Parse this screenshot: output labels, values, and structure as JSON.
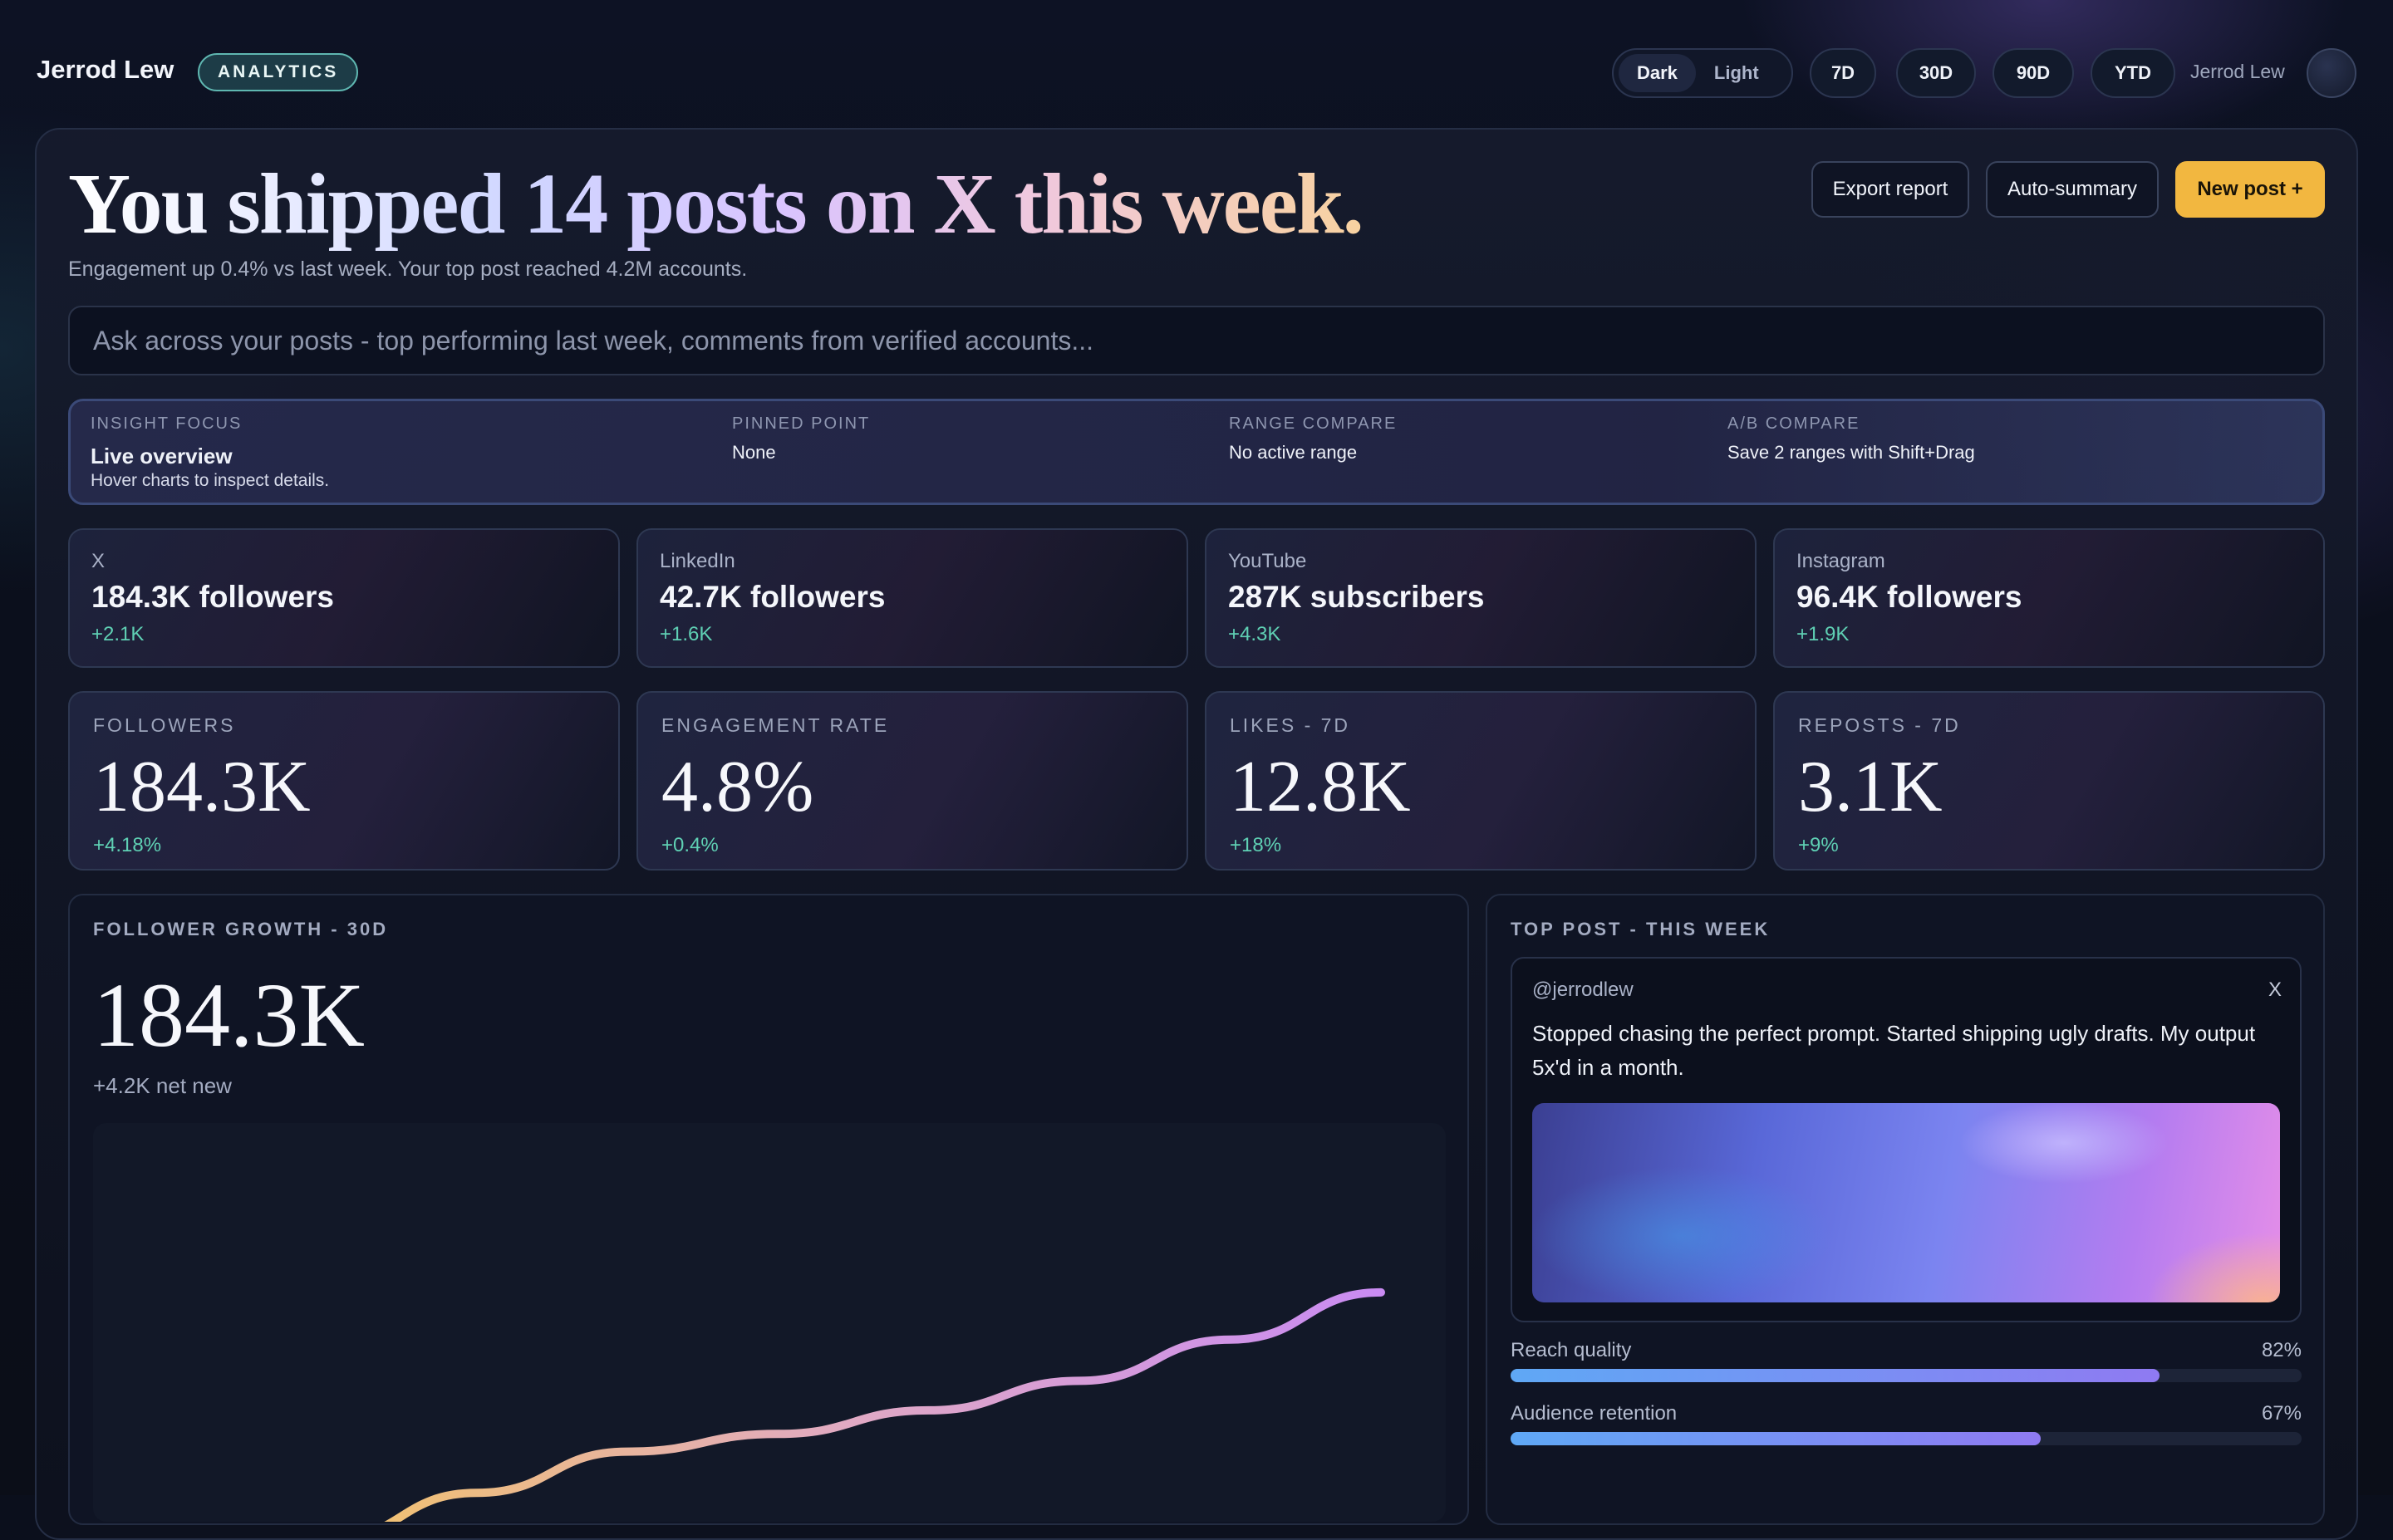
{
  "header": {
    "brand": "Jerrod Lew",
    "tag": "ANALYTICS",
    "theme_options": [
      "Dark",
      "Light"
    ],
    "theme_active": "Dark",
    "ranges": [
      "7D",
      "30D",
      "90D",
      "YTD"
    ],
    "user_name": "Jerrod Lew"
  },
  "hero": {
    "title": "You shipped 14 posts on X this week.",
    "subtitle": "Engagement up 0.4% vs last week. Your top post reached 4.2M accounts."
  },
  "actions": {
    "export": "Export report",
    "summary": "Auto-summary",
    "new_post": "New post +"
  },
  "search": {
    "placeholder": "Ask across your posts - top performing last week, comments from verified accounts..."
  },
  "insight": {
    "focus_label": "INSIGHT FOCUS",
    "focus_value": "Live overview",
    "focus_hint": "Hover charts to inspect details.",
    "pinned_label": "PINNED POINT",
    "pinned_value": "None",
    "range_label": "RANGE COMPARE",
    "range_value": "No active range",
    "ab_label": "A/B COMPARE",
    "ab_value": "Save 2 ranges with Shift+Drag"
  },
  "networks": [
    {
      "name": "X",
      "count": "184.3K followers",
      "delta": "+2.1K"
    },
    {
      "name": "LinkedIn",
      "count": "42.7K followers",
      "delta": "+1.6K"
    },
    {
      "name": "YouTube",
      "count": "287K subscribers",
      "delta": "+4.3K"
    },
    {
      "name": "Instagram",
      "count": "96.4K followers",
      "delta": "+1.9K"
    }
  ],
  "kpis": [
    {
      "label": "FOLLOWERS",
      "value": "184.3K",
      "delta": "+4.18%"
    },
    {
      "label": "ENGAGEMENT RATE",
      "value": "4.8%",
      "delta": "+0.4%"
    },
    {
      "label": "LIKES - 7D",
      "value": "12.8K",
      "delta": "+18%"
    },
    {
      "label": "REPOSTS - 7D",
      "value": "3.1K",
      "delta": "+9%"
    }
  ],
  "growth": {
    "label": "FOLLOWER GROWTH - 30D",
    "value": "184.3K",
    "net": "+4.2K net new"
  },
  "chart_data": {
    "type": "line",
    "title": "",
    "series": [
      {
        "values": [
          180.1,
          180.9,
          181.6,
          181.9,
          182.3,
          182.8,
          183.5,
          184.3
        ]
      }
    ],
    "colors": [
      "#f2c36b",
      "#e0a9c4",
      "#c98bf2"
    ],
    "grid": false
  },
  "top_post": {
    "label": "TOP POST - THIS WEEK",
    "handle": "@jerrodlew",
    "platform": "X",
    "text": "Stopped chasing the perfect prompt. Started shipping ugly drafts. My output 5x'd in a month.",
    "metrics": [
      {
        "name": "Reach quality",
        "pct": "82%",
        "value": 82
      },
      {
        "name": "Audience retention",
        "pct": "67%",
        "value": 67
      }
    ]
  },
  "colors": {
    "accent": "#f2b740",
    "positive": "#5fd0b4",
    "background": "#0b0f1c"
  }
}
